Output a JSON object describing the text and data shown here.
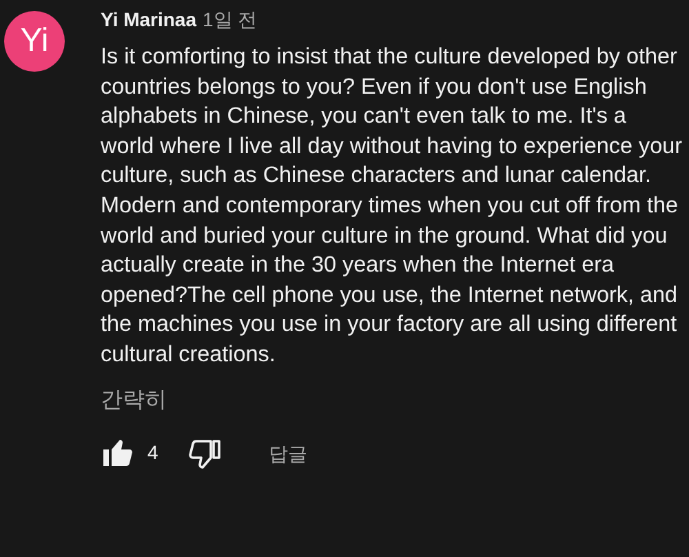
{
  "comment": {
    "avatar_initials": "Yi",
    "author": "Yi Marinaa",
    "time": "1일 전",
    "text": "Is it comforting to insist that the culture developed by other countries belongs to you? Even if you don't use English alphabets in Chinese, you can't even talk to me. It's a world where I live all day without having to experience your culture, such as Chinese characters and lunar calendar. Modern and contemporary times when you cut off from the world and buried your culture in the ground. What did you actually create in the 30 years when the Internet era opened?The cell phone you use, the Internet network, and the machines you use in your factory are all using different cultural creations.",
    "collapse_link": "간략히",
    "liked": true,
    "like_count": "4",
    "disliked": false,
    "reply_label": "답글"
  }
}
